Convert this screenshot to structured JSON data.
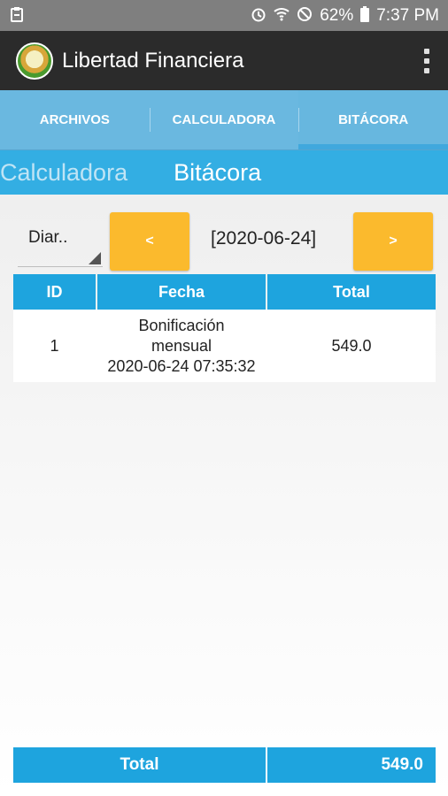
{
  "status_bar": {
    "battery": "62%",
    "time": "7:37 PM",
    "icons": [
      "clipboard-icon",
      "alarm-icon",
      "wifi-icon",
      "do-not-disturb-icon",
      "battery-icon"
    ]
  },
  "app_bar": {
    "title": "Libertad Financiera",
    "icons": [
      "app-logo",
      "overflow-menu-icon"
    ]
  },
  "tabs": [
    {
      "label": "ARCHIVOS",
      "active": false
    },
    {
      "label": "CALCULADORA",
      "active": false
    },
    {
      "label": "BITÁCORA",
      "active": true
    }
  ],
  "subtabs": [
    {
      "label": "Calculadora",
      "active": false
    },
    {
      "label": "Bitácora",
      "active": true
    }
  ],
  "nav": {
    "period": "Diar..",
    "prev_label": "<",
    "date": "[2020-06-24]",
    "next_label": ">"
  },
  "table": {
    "headers": [
      "ID",
      "Fecha",
      "Total"
    ],
    "rows": [
      {
        "id": "1",
        "fecha_line1": "Bonificación",
        "fecha_line2": "mensual",
        "fecha_line3": "2020-06-24 07:35:32",
        "total": "549.0"
      }
    ]
  },
  "footer": {
    "label": "Total",
    "value": "549.0"
  },
  "colors": {
    "status_bar": "#7f7f7f",
    "app_bar": "#2b2b2b",
    "tabs": "#6ab8e0",
    "subtabs": "#33aee3",
    "table_header": "#1ea4de",
    "nav_button": "#fbba2d"
  }
}
